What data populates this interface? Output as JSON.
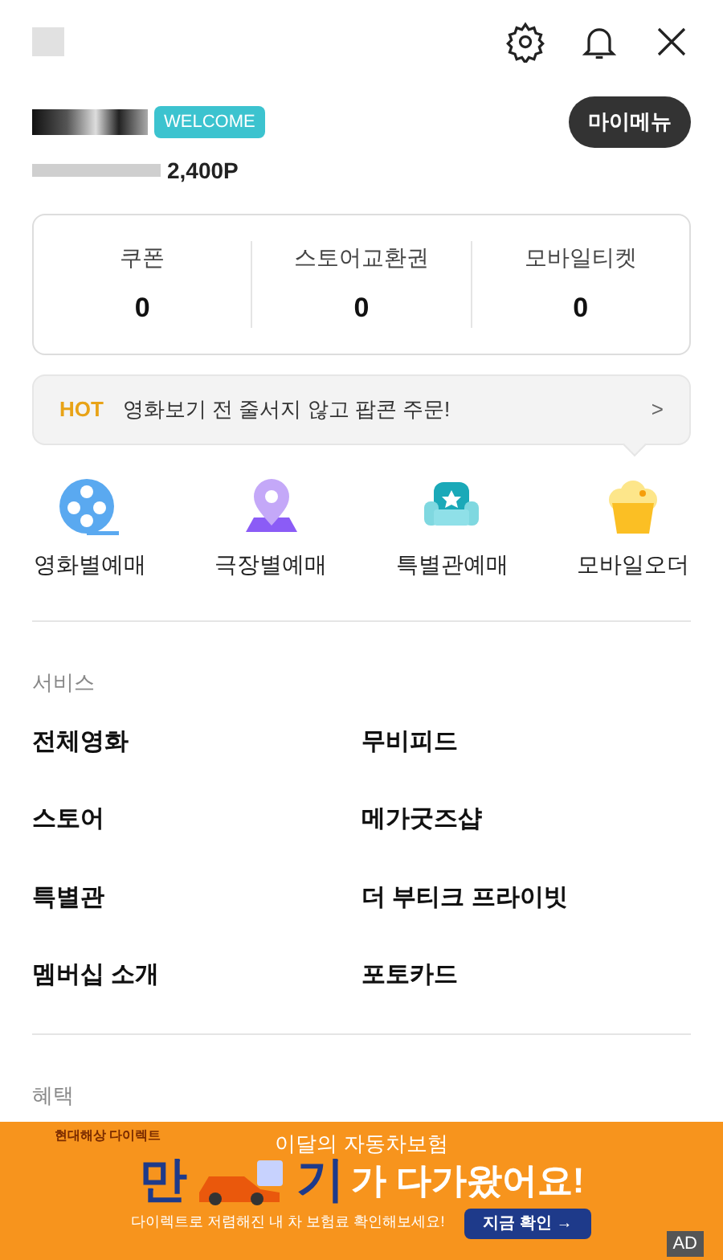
{
  "header": {
    "badge": "WELCOME",
    "my_menu": "마이메뉴",
    "points": "2,400P"
  },
  "stats": [
    {
      "label": "쿠폰",
      "value": "0"
    },
    {
      "label": "스토어교환권",
      "value": "0"
    },
    {
      "label": "모바일티켓",
      "value": "0"
    }
  ],
  "notice": {
    "tag": "HOT",
    "text": "영화보기 전 줄서지 않고 팝콘 주문!",
    "arrow": ">"
  },
  "quick_menu": [
    {
      "kind": "film",
      "label": "영화별예매"
    },
    {
      "kind": "pin",
      "label": "극장별예매"
    },
    {
      "kind": "sofa",
      "label": "특별관예매"
    },
    {
      "kind": "popcorn",
      "label": "모바일오더"
    }
  ],
  "sections": [
    {
      "title": "서비스",
      "items": [
        "전체영화",
        "무비피드",
        "스토어",
        "메가굿즈샵",
        "특별관",
        "더 부티크 프라이빗",
        "멤버십 소개",
        "포토카드"
      ]
    },
    {
      "title": "혜택"
    }
  ],
  "ad": {
    "brand": "현대해상 다이렉트",
    "headline": "이달의 자동차보험",
    "big_1": "만",
    "big_2": "기",
    "big_rest": "가 다가왔어요!",
    "sub": "다이렉트로 저렴해진 내 차 보험료 확인해보세요!",
    "cta": "지금 확인 →",
    "ad_mark": "AD"
  }
}
